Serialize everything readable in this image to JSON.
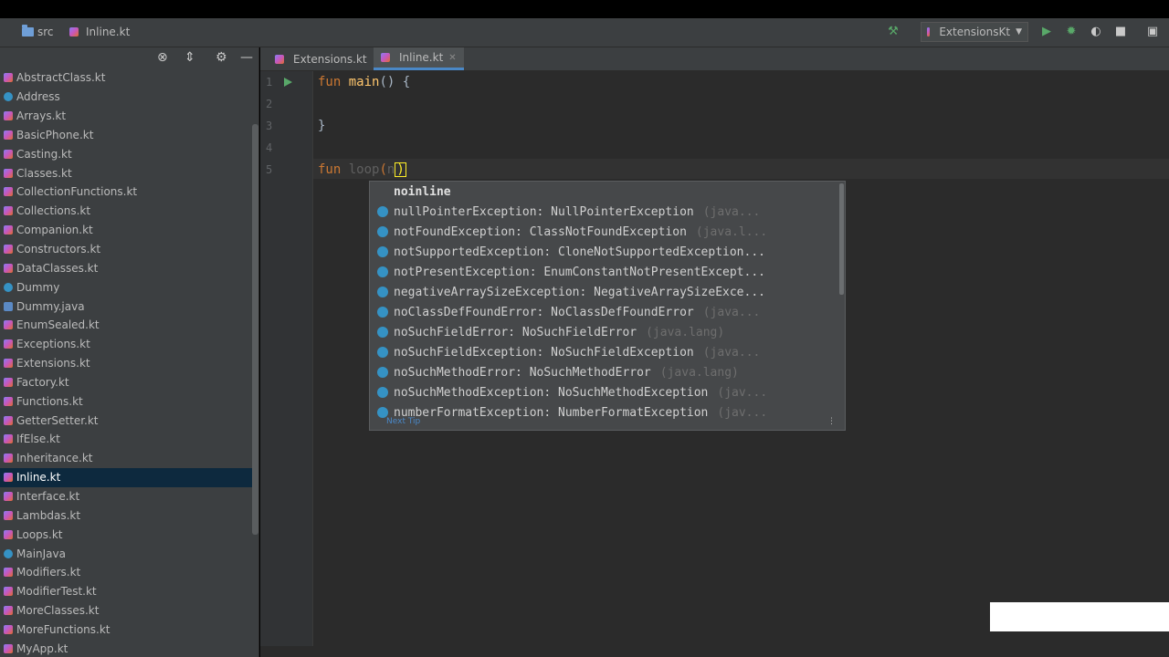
{
  "navbar": {
    "crumbs": [
      "src",
      "Inline.kt"
    ],
    "run_config": "ExtensionsKt",
    "run_config_arrow": "▼"
  },
  "project_panel": {
    "files": [
      {
        "name": "AbstractClass.kt",
        "icon": "kotlin-file-icon"
      },
      {
        "name": "Address",
        "icon": "class-icon"
      },
      {
        "name": "Arrays.kt",
        "icon": "kotlin-file-icon"
      },
      {
        "name": "BasicPhone.kt",
        "icon": "kotlin-file-icon"
      },
      {
        "name": "Casting.kt",
        "icon": "kotlin-file-icon"
      },
      {
        "name": "Classes.kt",
        "icon": "kotlin-file-icon"
      },
      {
        "name": "CollectionFunctions.kt",
        "icon": "kotlin-file-icon"
      },
      {
        "name": "Collections.kt",
        "icon": "kotlin-file-icon"
      },
      {
        "name": "Companion.kt",
        "icon": "kotlin-file-icon"
      },
      {
        "name": "Constructors.kt",
        "icon": "kotlin-file-icon"
      },
      {
        "name": "DataClasses.kt",
        "icon": "kotlin-file-icon"
      },
      {
        "name": "Dummy",
        "icon": "class-icon"
      },
      {
        "name": "Dummy.java",
        "icon": "java-file-icon"
      },
      {
        "name": "EnumSealed.kt",
        "icon": "kotlin-file-icon"
      },
      {
        "name": "Exceptions.kt",
        "icon": "kotlin-file-icon"
      },
      {
        "name": "Extensions.kt",
        "icon": "kotlin-file-icon"
      },
      {
        "name": "Factory.kt",
        "icon": "kotlin-file-icon"
      },
      {
        "name": "Functions.kt",
        "icon": "kotlin-file-icon"
      },
      {
        "name": "GetterSetter.kt",
        "icon": "kotlin-file-icon"
      },
      {
        "name": "IfElse.kt",
        "icon": "kotlin-file-icon"
      },
      {
        "name": "Inheritance.kt",
        "icon": "kotlin-file-icon"
      },
      {
        "name": "Inline.kt",
        "icon": "kotlin-file-icon",
        "selected": true
      },
      {
        "name": "Interface.kt",
        "icon": "kotlin-file-icon"
      },
      {
        "name": "Lambdas.kt",
        "icon": "kotlin-file-icon"
      },
      {
        "name": "Loops.kt",
        "icon": "kotlin-file-icon"
      },
      {
        "name": "MainJava",
        "icon": "class-icon"
      },
      {
        "name": "Modifiers.kt",
        "icon": "kotlin-file-icon"
      },
      {
        "name": "ModifierTest.kt",
        "icon": "kotlin-file-icon"
      },
      {
        "name": "MoreClasses.kt",
        "icon": "kotlin-file-icon"
      },
      {
        "name": "MoreFunctions.kt",
        "icon": "kotlin-file-icon"
      },
      {
        "name": "MyApp.kt",
        "icon": "kotlin-file-icon"
      }
    ]
  },
  "tabs": [
    {
      "label": "Extensions.kt",
      "active": false
    },
    {
      "label": "Inline.kt",
      "active": true
    }
  ],
  "editor": {
    "line_numbers": [
      "1",
      "2",
      "3",
      "4",
      "5"
    ],
    "line1": {
      "kw": "fun",
      "name": "main",
      "rest": "() {"
    },
    "line3": "}",
    "line5": {
      "kw": "fun",
      "name": "loop",
      "open": "(",
      "typed": "n",
      "close": ")"
    }
  },
  "completion": {
    "keyword": "noinline",
    "items": [
      {
        "name": "nullPointerException: NullPointerException",
        "pkg": "(java..."
      },
      {
        "name": "notFoundException: ClassNotFoundException",
        "pkg": "(java.l..."
      },
      {
        "name": "notSupportedException: CloneNotSupportedException...",
        "pkg": ""
      },
      {
        "name": "notPresentException: EnumConstantNotPresentExcept...",
        "pkg": ""
      },
      {
        "name": "negativeArraySizeException: NegativeArraySizeExce...",
        "pkg": ""
      },
      {
        "name": "noClassDefFoundError: NoClassDefFoundError",
        "pkg": "(java..."
      },
      {
        "name": "noSuchFieldError: NoSuchFieldError",
        "pkg": "(java.lang)"
      },
      {
        "name": "noSuchFieldException: NoSuchFieldException",
        "pkg": "(java..."
      },
      {
        "name": "noSuchMethodError: NoSuchMethodError",
        "pkg": "(java.lang)"
      },
      {
        "name": "noSuchMethodException: NoSuchMethodException",
        "pkg": "(jav..."
      },
      {
        "name": "numberFormatException: NumberFormatException",
        "pkg": "(jav..."
      }
    ],
    "footer_tip": "Next Tip",
    "footer_pi": "⋮"
  }
}
